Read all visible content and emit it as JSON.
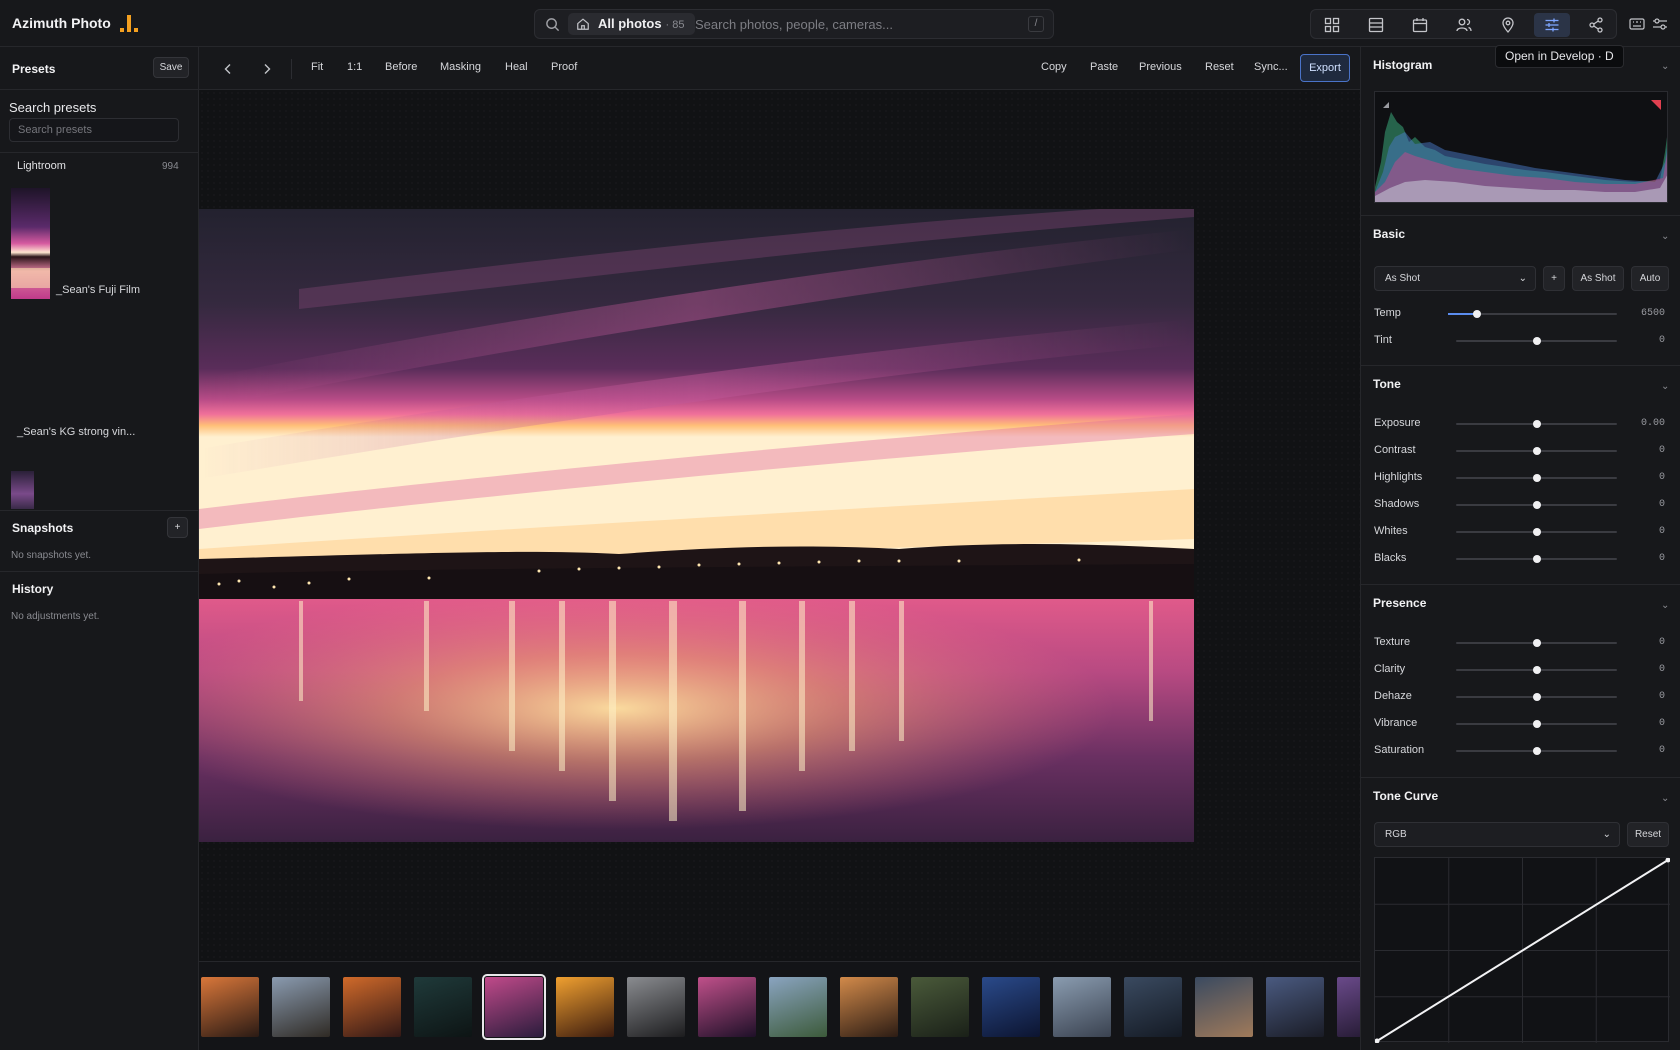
{
  "app": {
    "title": "Azimuth Photo"
  },
  "search": {
    "scope_label": "All photos",
    "scope_count": "· 85",
    "placeholder": "Search photos, people, cameras...",
    "shortcut": "/"
  },
  "view_switcher": [
    "grid-icon",
    "list-icon",
    "calendar-icon",
    "people-icon",
    "map-pin-icon",
    "sliders-icon",
    "share-icon"
  ],
  "tooltip": "Open in Develop · D",
  "left": {
    "presets_title": "Presets",
    "save_label": "Save",
    "search_label": "Search presets",
    "search_placeholder": "Search presets",
    "group_name": "Lightroom",
    "group_count": "994",
    "presets": [
      "_Sean's Fuji Film",
      "_Sean's KG strong vin..."
    ],
    "snapshots_title": "Snapshots",
    "snapshots_add": "+",
    "snapshots_empty": "No snapshots yet.",
    "history_title": "History",
    "history_empty": "No adjustments yet."
  },
  "toolbar": {
    "left_items": [
      "Fit",
      "1:1",
      "Before",
      "Masking",
      "Heal",
      "Proof"
    ],
    "right_items": [
      "Copy",
      "Paste",
      "Previous",
      "Reset",
      "Sync..."
    ],
    "export_label": "Export"
  },
  "right": {
    "histogram_title": "Histogram",
    "basic_title": "Basic",
    "wb_select": "As Shot",
    "wb_add": "+",
    "wb_as_shot": "As Shot",
    "wb_auto": "Auto",
    "basic_sliders": [
      {
        "label": "Temp",
        "value": "6500",
        "position": 0.13
      },
      {
        "label": "Tint",
        "value": "0",
        "position": 0.5
      }
    ],
    "tone_title": "Tone",
    "tone_sliders": [
      {
        "label": "Exposure",
        "value": "0.00",
        "position": 0.5
      },
      {
        "label": "Contrast",
        "value": "0",
        "position": 0.5
      },
      {
        "label": "Highlights",
        "value": "0",
        "position": 0.5
      },
      {
        "label": "Shadows",
        "value": "0",
        "position": 0.5
      },
      {
        "label": "Whites",
        "value": "0",
        "position": 0.5
      },
      {
        "label": "Blacks",
        "value": "0",
        "position": 0.5
      }
    ],
    "presence_title": "Presence",
    "presence_sliders": [
      {
        "label": "Texture",
        "value": "0",
        "position": 0.5
      },
      {
        "label": "Clarity",
        "value": "0",
        "position": 0.5
      },
      {
        "label": "Dehaze",
        "value": "0",
        "position": 0.5
      },
      {
        "label": "Vibrance",
        "value": "0",
        "position": 0.5
      },
      {
        "label": "Saturation",
        "value": "0",
        "position": 0.5
      }
    ],
    "curve_title": "Tone Curve",
    "curve_channel": "RGB",
    "curve_reset": "Reset"
  },
  "filmstrip": {
    "selected_index": 4,
    "thumbs": [
      [
        "#d9773a",
        "#2a1a14"
      ],
      [
        "#8a9bb0",
        "#2f2a24"
      ],
      [
        "#d06a2a",
        "#321816"
      ],
      [
        "#1f3a3a",
        "#0d1414"
      ],
      [
        "#c04a8a",
        "#2a1c3c"
      ],
      [
        "#f0a030",
        "#3a1a0e"
      ],
      [
        "#8a8c90",
        "#1c1c1e"
      ],
      [
        "#c0508a",
        "#1e1028"
      ],
      [
        "#8aa4c0",
        "#3c5a3a"
      ],
      [
        "#d28a4a",
        "#2c1c14"
      ],
      [
        "#4a5a3a",
        "#1a2018"
      ],
      [
        "#2a4a8a",
        "#0c1430"
      ],
      [
        "#8a9cb0",
        "#3a4250"
      ],
      [
        "#3a4a60",
        "#141a24"
      ],
      [
        "#3a4a60",
        "#a07a5a"
      ],
      [
        "#4a5a80",
        "#1a1c26"
      ],
      [
        "#6a4a8a",
        "#1c1428"
      ]
    ]
  },
  "colors": {
    "accent": "#5b8def",
    "panel": "#17181b",
    "canvas": "#111214"
  }
}
